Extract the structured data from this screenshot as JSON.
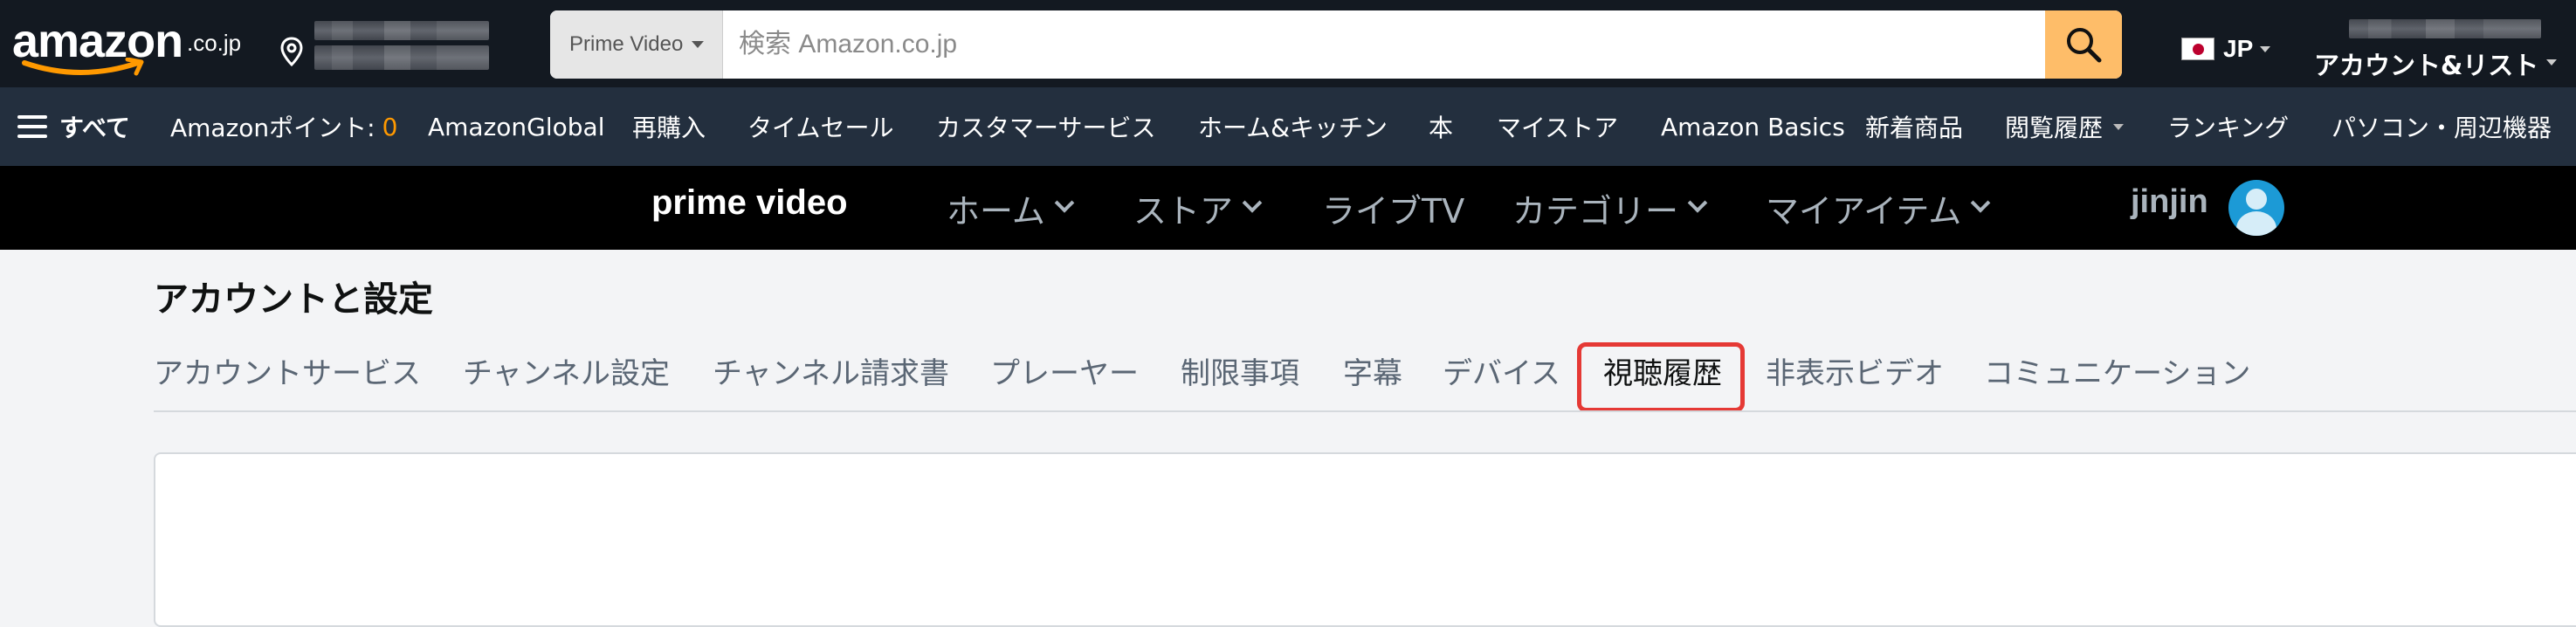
{
  "header": {
    "logo": {
      "text": "amazon",
      "tld": ".co.jp"
    },
    "search": {
      "category": "Prime Video",
      "placeholder": "検索 Amazon.co.jp"
    },
    "language": {
      "code": "JP"
    },
    "account": {
      "label": "アカウント&リスト"
    }
  },
  "subnav": {
    "all_label": "すべて",
    "points_label": "Amazonポイント:",
    "points_value": "0",
    "items": [
      "AmazonGlobal",
      "再購入",
      "タイムセール",
      "カスタマーサービス",
      "ホーム&キッチン",
      "本",
      "マイストア",
      "Amazon Basics",
      "新着商品",
      "閲覧履歴",
      "ランキング",
      "パソコン・周辺機器"
    ]
  },
  "prime": {
    "brand": "prime video",
    "menu": [
      "ホーム",
      "ストア",
      "ライブTV",
      "カテゴリー",
      "マイアイテム"
    ],
    "user": "jinjin"
  },
  "settings": {
    "title": "アカウントと設定",
    "tabs": [
      "アカウントサービス",
      "チャンネル設定",
      "チャンネル請求書",
      "プレーヤー",
      "制限事項",
      "字幕",
      "デバイス",
      "視聴履歴",
      "非表示ビデオ",
      "コミュニケーション"
    ],
    "active_tab": "視聴履歴"
  },
  "colors": {
    "top_bg": "#131921",
    "subnav_bg": "#232f3e",
    "prime_bg": "#000000",
    "search_button": "#febd69",
    "points_accent": "#ff9900",
    "highlight": "#e53935"
  },
  "icons": [
    "location-pin-icon",
    "search-icon",
    "hamburger-icon",
    "chevron-down-icon",
    "avatar-icon"
  ]
}
